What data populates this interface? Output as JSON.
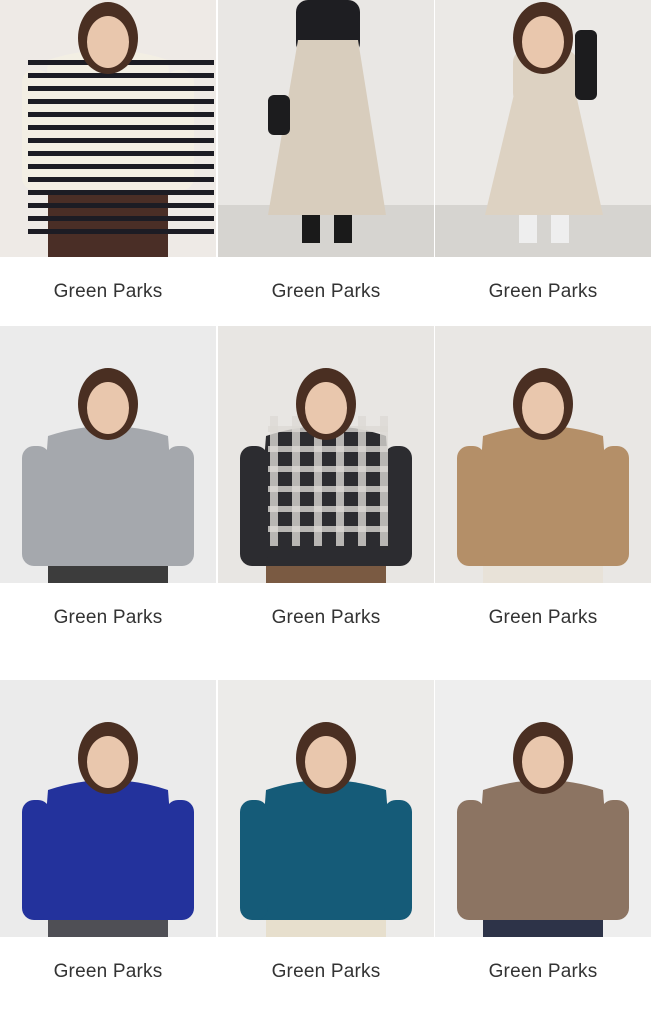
{
  "products": [
    {
      "brand": "Green Parks",
      "image": "striped-knit-sweater-photo",
      "colors": {
        "bg": "#eeeae6",
        "top": "#f3efe4",
        "accent": "#1c1c24",
        "bottom": "#4a2e26"
      }
    },
    {
      "brand": "Green Parks",
      "image": "beige-mermaid-skirt-photo",
      "colors": {
        "bg": "#e9e7e4",
        "top": "#1e1e22",
        "accent": "#d8cdbd",
        "bottom": "#1a1a1a"
      }
    },
    {
      "brand": "Green Parks",
      "image": "beige-long-dress-photo",
      "colors": {
        "bg": "#ebe9e6",
        "top": "#ddd2c2",
        "accent": "#1b1b1d",
        "bottom": "#eeeeee"
      }
    },
    {
      "brand": "Green Parks",
      "image": "gray-ribbed-turtleneck-photo",
      "colors": {
        "bg": "#ebebeb",
        "top": "#a5a8ad",
        "accent": "#3a3a3a",
        "bottom": "#3c3c3c"
      }
    },
    {
      "brand": "Green Parks",
      "image": "plaid-shirt-jacket-photo",
      "colors": {
        "bg": "#e8e6e3",
        "top": "#2c2c30",
        "accent": "#dcdad5",
        "bottom": "#7a5a42"
      }
    },
    {
      "brand": "Green Parks",
      "image": "camel-peplum-sweatshirt-photo",
      "colors": {
        "bg": "#e9e7e4",
        "top": "#b48f68",
        "accent": "#2a2a2a",
        "bottom": "#e8e2d8"
      }
    },
    {
      "brand": "Green Parks",
      "image": "royal-blue-knit-photo",
      "colors": {
        "bg": "#ebebeb",
        "top": "#23329c",
        "accent": "#1e1e1e",
        "bottom": "#4f4f55"
      }
    },
    {
      "brand": "Green Parks",
      "image": "teal-fringe-sweater-photo",
      "colors": {
        "bg": "#ecebe9",
        "top": "#155b78",
        "accent": "#7a4a2e",
        "bottom": "#e7dfcd"
      }
    },
    {
      "brand": "Green Parks",
      "image": "taupe-sweatshirt-photo",
      "colors": {
        "bg": "#eeeeee",
        "top": "#8c7462",
        "accent": "#7a4a2e",
        "bottom": "#2d3348"
      }
    }
  ]
}
